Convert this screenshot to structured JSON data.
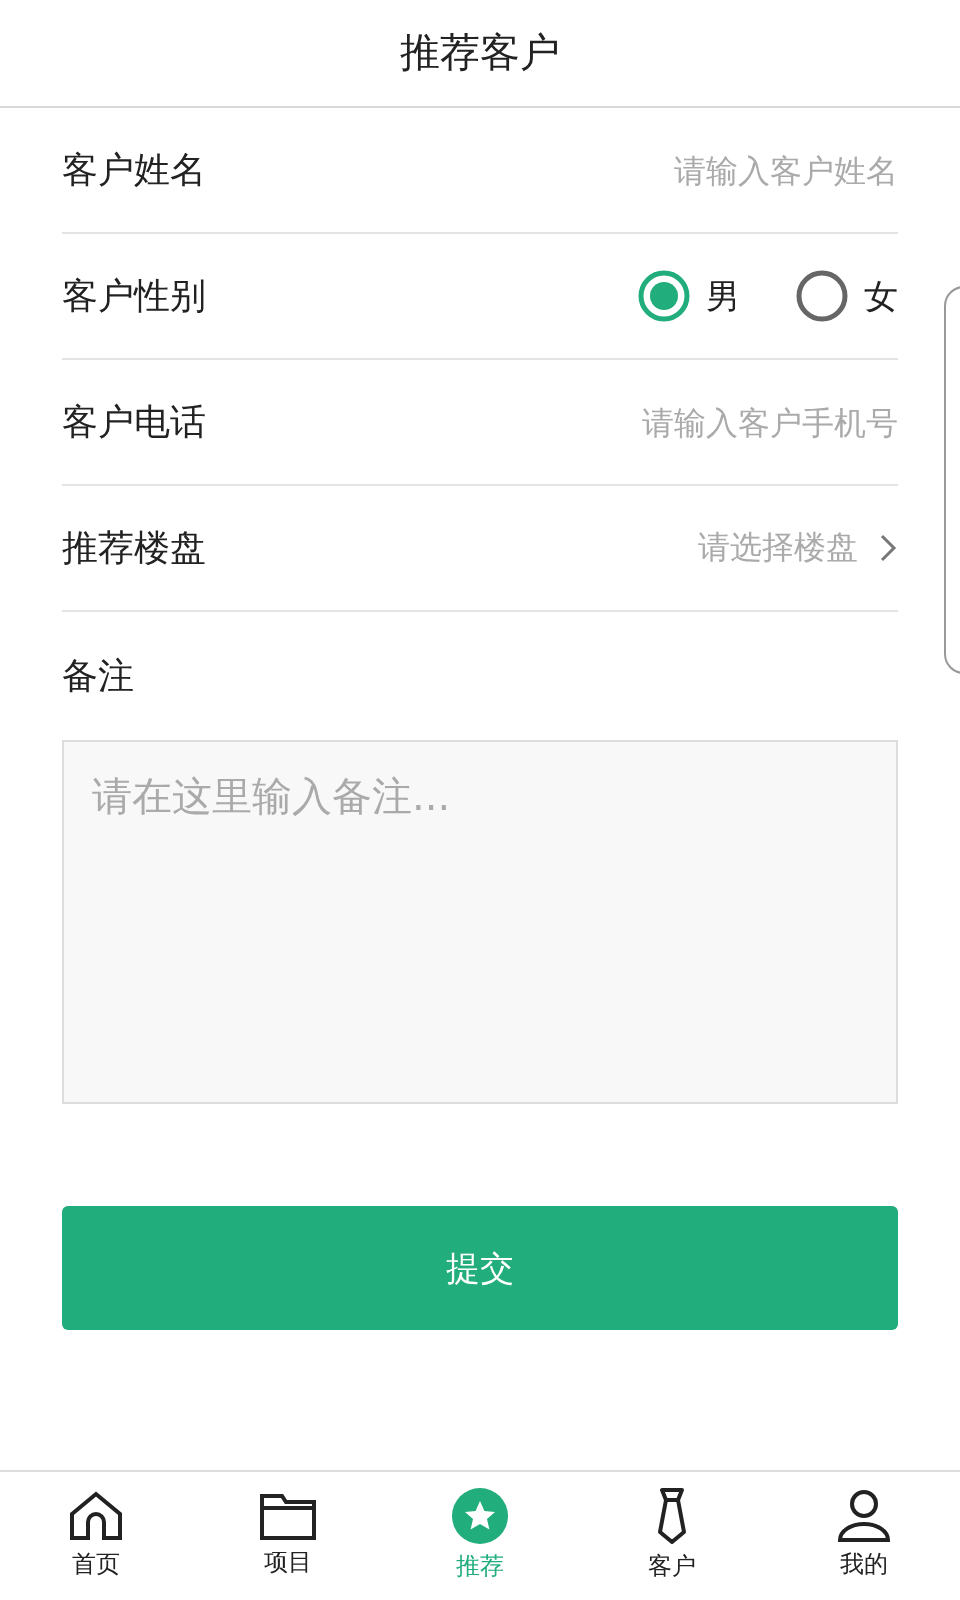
{
  "header": {
    "title": "推荐客户"
  },
  "fields": [
    {
      "kind": "input",
      "label": "客户姓名",
      "placeholder": "请输入客户姓名"
    },
    {
      "kind": "radio",
      "label": "客户性别",
      "options": [
        {
          "label": "男",
          "selected": true
        },
        {
          "label": "女",
          "selected": false
        }
      ]
    },
    {
      "kind": "input",
      "label": "客户电话",
      "placeholder": "请输入客户手机号"
    },
    {
      "kind": "select",
      "label": "推荐楼盘",
      "placeholder": "请选择楼盘"
    }
  ],
  "remark": {
    "label": "备注",
    "placeholder": "请在这里输入备注..."
  },
  "submit": "提交",
  "nav": [
    {
      "label": "首页",
      "selected": false
    },
    {
      "label": "项目",
      "selected": false
    },
    {
      "label": "推荐",
      "selected": true
    },
    {
      "label": "客户",
      "selected": false
    },
    {
      "label": "我的",
      "selected": false
    }
  ]
}
